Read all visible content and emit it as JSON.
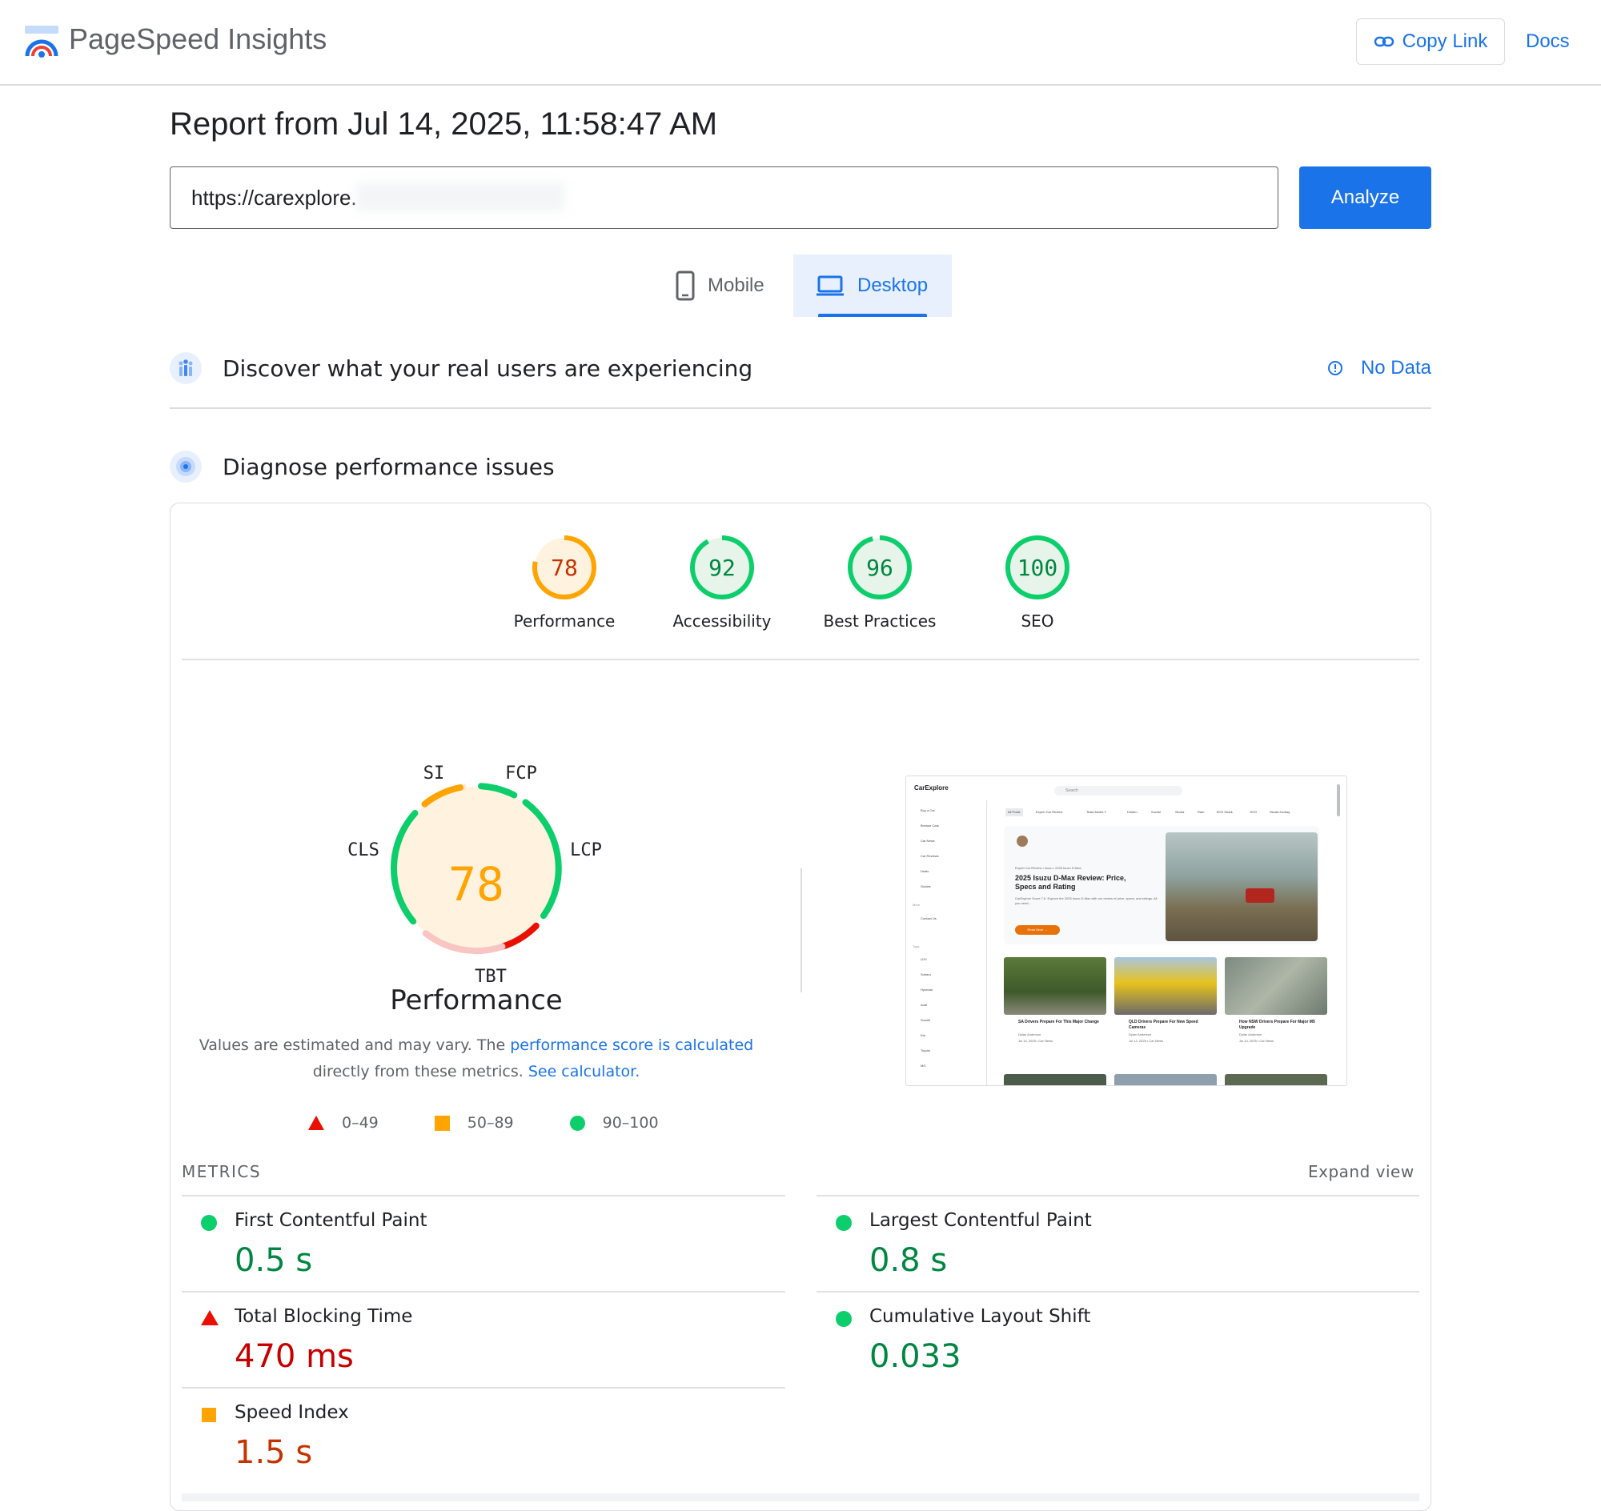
{
  "header": {
    "app_title": "PageSpeed Insights",
    "copy_link_label": "Copy Link",
    "docs_label": "Docs"
  },
  "report": {
    "title": "Report from Jul 14, 2025, 11:58:47 AM",
    "url_value": "https://carexplore.",
    "analyze_label": "Analyze"
  },
  "tabs": {
    "mobile_label": "Mobile",
    "desktop_label": "Desktop",
    "selected": "Desktop"
  },
  "real_users": {
    "title": "Discover what your real users are experiencing",
    "status": "No Data"
  },
  "diagnose": {
    "title": "Diagnose performance issues"
  },
  "scores": [
    {
      "label": "Performance",
      "value": 78,
      "rating": "average"
    },
    {
      "label": "Accessibility",
      "value": 92,
      "rating": "pass"
    },
    {
      "label": "Best Practices",
      "value": 96,
      "rating": "pass"
    },
    {
      "label": "SEO",
      "value": 100,
      "rating": "pass"
    }
  ],
  "performance_gauge": {
    "score": "78",
    "title": "Performance",
    "segments": [
      "SI",
      "FCP",
      "LCP",
      "TBT",
      "CLS"
    ],
    "note_prefix": "Values are estimated and may vary. The ",
    "note_link": "performance score is calculated",
    "note_middle": " directly from these metrics. ",
    "note_link2": "See calculator."
  },
  "legend": {
    "fail": "0–49",
    "average": "50–89",
    "pass": "90–100"
  },
  "metrics": {
    "label": "METRICS",
    "expand_label": "Expand view",
    "items": [
      {
        "name": "First Contentful Paint",
        "value": "0.5 s",
        "rating": "pass"
      },
      {
        "name": "Largest Contentful Paint",
        "value": "0.8 s",
        "rating": "pass"
      },
      {
        "name": "Total Blocking Time",
        "value": "470 ms",
        "rating": "fail"
      },
      {
        "name": "Cumulative Layout Shift",
        "value": "0.033",
        "rating": "pass"
      },
      {
        "name": "Speed Index",
        "value": "1.5 s",
        "rating": "average"
      }
    ]
  },
  "colors": {
    "accent": "#1a73e8",
    "pass": "#0cce6b",
    "average": "#ffa400",
    "fail": "#eb0f00"
  },
  "thumbnail": {
    "brand": "CarExplore",
    "search_placeholder": "Search",
    "sidebar": [
      "Buy a Car",
      "Browse Cars",
      "Car News",
      "Car Reviews",
      "Deals",
      "Guides",
      "More",
      "Contact Us",
      "Tags",
      "LDV",
      "Subaru",
      "Hyundai",
      "Audi",
      "Suzuki",
      "Kia",
      "Toyota",
      "MG"
    ],
    "chips": [
      "All Posts",
      "Expert Car Review",
      "Tesla Model Y",
      "Holden",
      "Suzuki",
      "Skoda",
      "Ram",
      "BYD Shark",
      "BYD",
      "Skoda Kodiaq"
    ],
    "hero_breadcrumb": "Expert Car Review • Isuzu • 2025 Isuzu D-Max",
    "hero_title": "2025 Isuzu D-Max Review: Price, Specs and Rating",
    "hero_text": "CarExplore Score 7.6. Explore the 2025 Isuzu D-Max with our review of price, specs, and ratings. All you need...",
    "hero_button": "Read More →",
    "cards": [
      {
        "title": "SA Drivers Prepare For This Major Change",
        "author": "Dylan Anderson",
        "meta": "Jul 14, 2025 • Car News"
      },
      {
        "title": "QLD Drivers Prepare For New Speed Cameras",
        "author": "Dylan Anderson",
        "meta": "Jul 13, 2025 • Car News"
      },
      {
        "title": "How NSW Drivers Prepare For Major M5 Upgrade",
        "author": "Dylan Anderson",
        "meta": "Jul 13, 2025 • Car News"
      }
    ]
  }
}
